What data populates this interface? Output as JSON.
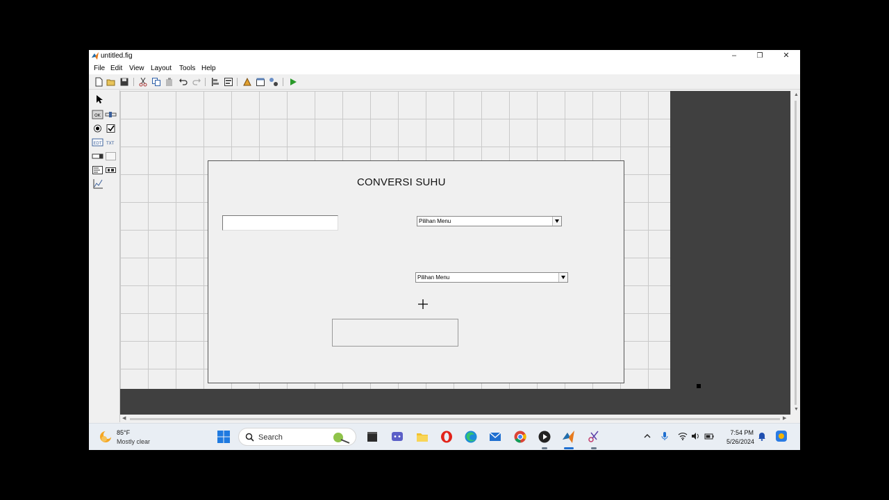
{
  "window": {
    "title": "untitled.fig",
    "controls": {
      "minimize": "–",
      "maximize": "❐",
      "close": "✕"
    }
  },
  "menu": {
    "items": [
      "File",
      "Edit",
      "View",
      "Layout",
      "Tools",
      "Help"
    ]
  },
  "toolbar": {
    "icons": [
      "new-file-icon",
      "open-icon",
      "save-icon",
      "cut-icon",
      "copy-icon",
      "paste-icon",
      "undo-icon",
      "redo-icon",
      "align-icon",
      "menu-editor-icon",
      "tab-order-icon",
      "toolbar-editor-icon",
      "editor-icon",
      "run-icon"
    ]
  },
  "palette": {
    "tools": [
      "select-tool",
      "push-button",
      "slider",
      "radio-button",
      "check-box",
      "edit-text",
      "static-text",
      "popup-menu",
      "listbox",
      "toggle-button",
      "table",
      "axes",
      "panel",
      "button-group",
      "activex"
    ]
  },
  "figure": {
    "title": "CONVERSI SUHU",
    "edit_value": "",
    "popup1": {
      "selected": "Pilihan Menu"
    },
    "popup2": {
      "selected": "Pilihan Menu"
    },
    "push_button_label": ""
  },
  "taskbar": {
    "weather": {
      "temp": "85°F",
      "desc": "Mostly clear"
    },
    "search_label": "Search",
    "clock": {
      "time": "7:54 PM",
      "date": "5/26/2024"
    },
    "apps": [
      "windows-start-icon",
      "search-icon",
      "copilot-icon",
      "terminal-icon",
      "teams-icon",
      "file-explorer-icon",
      "opera-icon",
      "edge-icon",
      "mail-icon",
      "chrome-icon",
      "media-player-icon",
      "matlab-icon",
      "snipping-tool-icon"
    ],
    "tray": [
      "chevron-up-icon",
      "microphone-icon",
      "wifi-icon",
      "volume-icon",
      "battery-icon",
      "notification-bell-icon",
      "copilot-pre-icon"
    ]
  },
  "colors": {
    "canvas_bg": "#f0f0f0",
    "grid_line": "#c9c9c9",
    "outside_gray": "#404040",
    "taskbar_bg": "#e9eef4"
  }
}
